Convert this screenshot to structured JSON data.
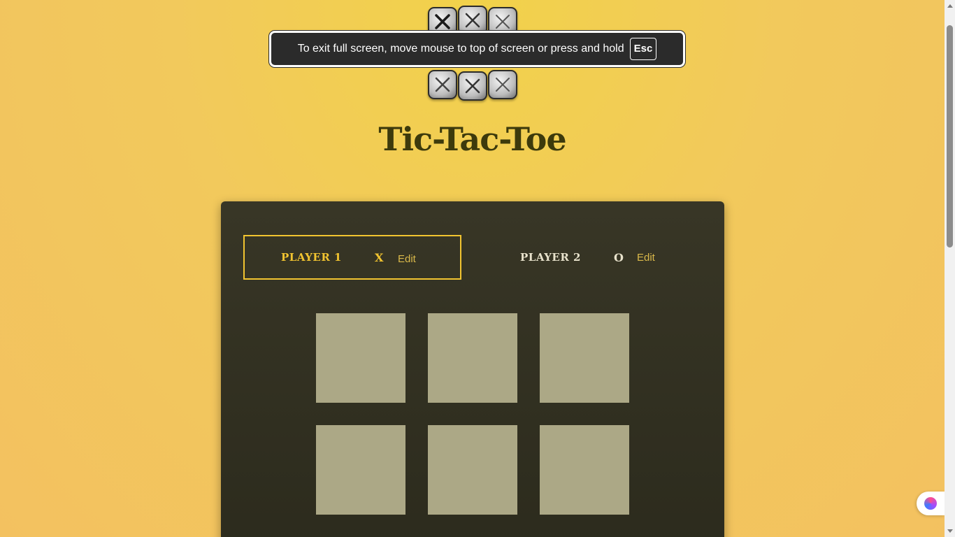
{
  "app": {
    "title": "Tic-Tac-Toe",
    "logo_icon": "tic-tac-toe-tiles-logo"
  },
  "fullscreen_notice": {
    "text": "To exit full screen, move mouse to top of screen or press and hold",
    "key": "Esc"
  },
  "players": [
    {
      "name": "PLAYER 1",
      "symbol": "X",
      "edit_label": "Edit",
      "active": true
    },
    {
      "name": "PLAYER 2",
      "symbol": "O",
      "edit_label": "Edit",
      "active": false
    }
  ],
  "board": {
    "cells": [
      "",
      "",
      "",
      "",
      "",
      ""
    ]
  },
  "colors": {
    "background": "#f2c95c",
    "panel": "#2f2e20",
    "accent": "#f2c430",
    "cell": "#aca886",
    "title": "#3d3a0c"
  },
  "extension_widget_icon": "brain-icon"
}
